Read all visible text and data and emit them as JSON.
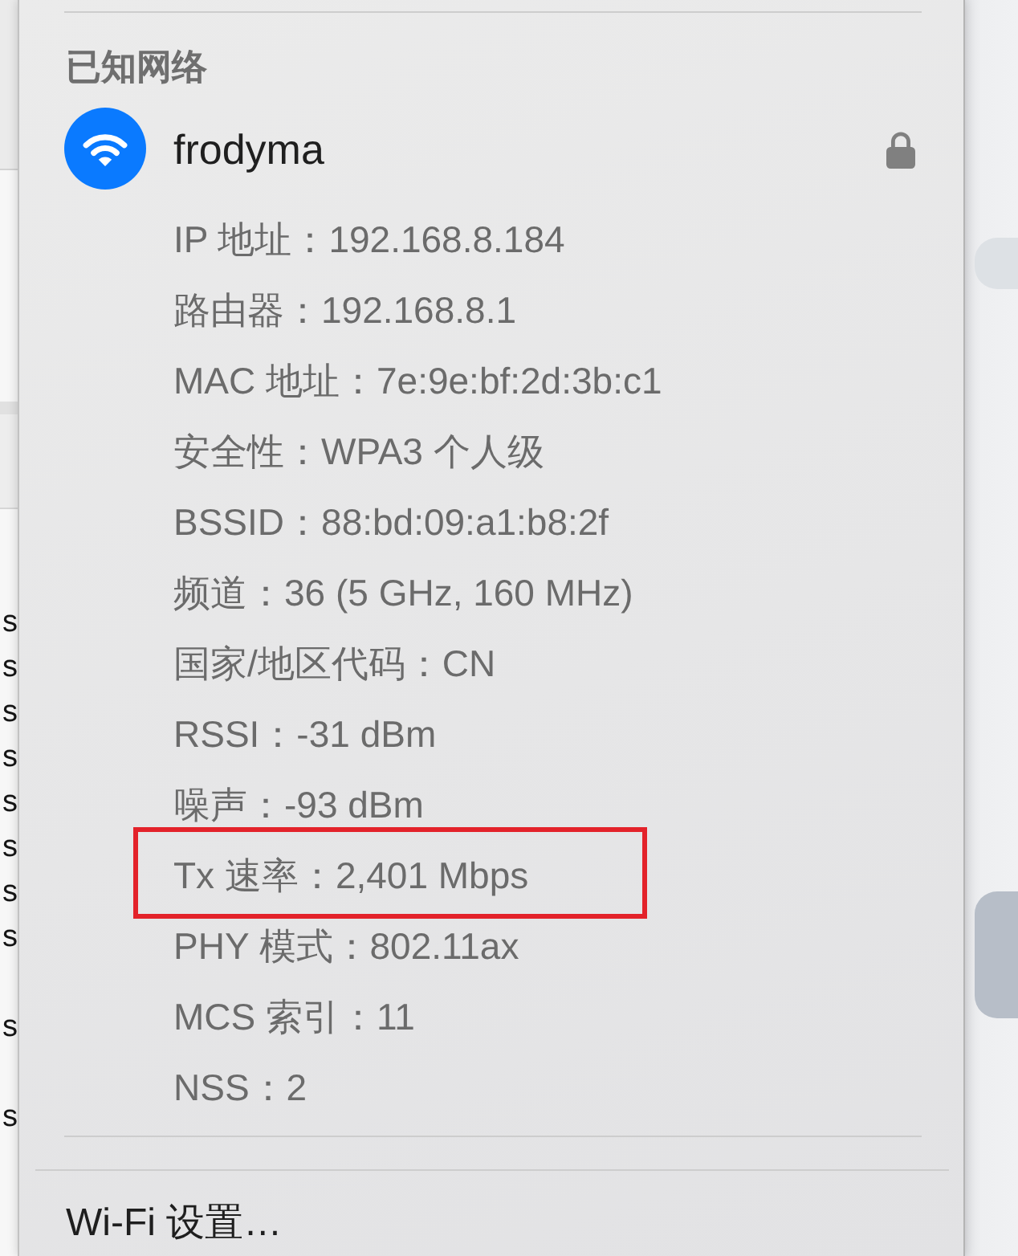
{
  "background_window": {
    "rows": [
      "s",
      "s",
      "s",
      "s",
      "s",
      "s",
      "s",
      "s",
      "s",
      "s"
    ]
  },
  "menu": {
    "section_title": "已知网络",
    "network": {
      "name": "frodyma",
      "connected": true,
      "secured": true
    },
    "details": [
      {
        "text": "IP 地址：192.168.8.184",
        "highlighted": false
      },
      {
        "text": "路由器：192.168.8.1",
        "highlighted": false
      },
      {
        "text": "MAC 地址：7e:9e:bf:2d:3b:c1",
        "highlighted": false
      },
      {
        "text": "安全性：WPA3 个人级",
        "highlighted": false
      },
      {
        "text": "BSSID：88:bd:09:a1:b8:2f",
        "highlighted": false
      },
      {
        "text": "频道：36 (5 GHz, 160 MHz)",
        "highlighted": false
      },
      {
        "text": "国家/地区代码：CN",
        "highlighted": false
      },
      {
        "text": "RSSI：-31 dBm",
        "highlighted": false
      },
      {
        "text": "噪声：-93 dBm",
        "highlighted": false
      },
      {
        "text": "Tx 速率：2,401 Mbps",
        "highlighted": true
      },
      {
        "text": "PHY 模式：802.11ax",
        "highlighted": false
      },
      {
        "text": "MCS 索引：11",
        "highlighted": false
      },
      {
        "text": "NSS：2",
        "highlighted": false
      }
    ],
    "settings_item": "Wi-Fi 设置…"
  }
}
